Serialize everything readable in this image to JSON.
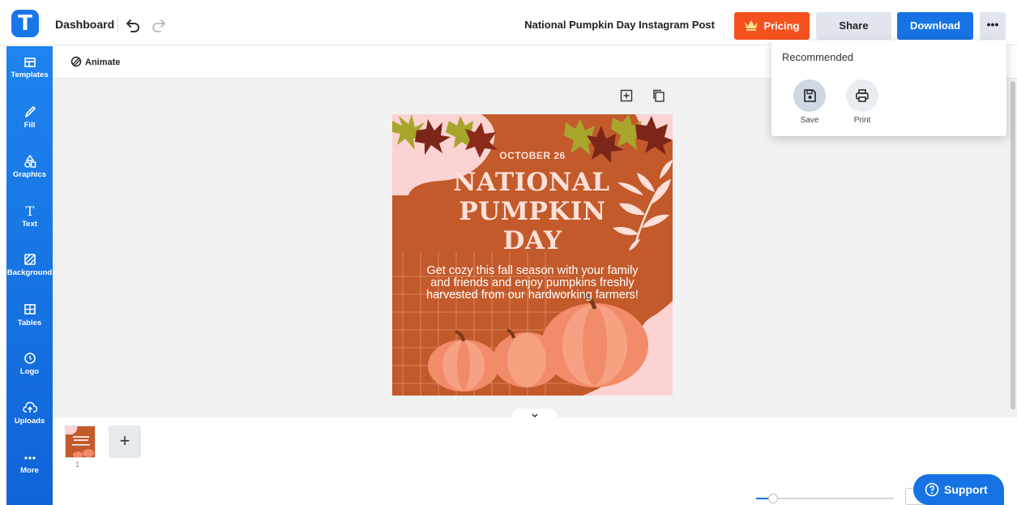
{
  "app": {
    "logo_letter": "T"
  },
  "header": {
    "dashboard_label": "Dashboard",
    "document_title": "National Pumpkin Day Instagram Post",
    "pricing_label": "Pricing",
    "share_label": "Share",
    "download_label": "Download",
    "more_label": "•••",
    "colors": {
      "pricing": "#f4511e",
      "download": "#1773e3",
      "sidebar": "#1877e8"
    }
  },
  "sidebar": {
    "items": [
      {
        "label": "Templates",
        "icon": "templates-icon"
      },
      {
        "label": "Fill",
        "icon": "pencil-icon"
      },
      {
        "label": "Graphics",
        "icon": "shapes-icon"
      },
      {
        "label": "Text",
        "icon": "text-icon"
      },
      {
        "label": "Background",
        "icon": "background-icon"
      },
      {
        "label": "Tables",
        "icon": "table-icon"
      },
      {
        "label": "Logo",
        "icon": "logo-icon"
      },
      {
        "label": "Uploads",
        "icon": "cloud-upload-icon"
      },
      {
        "label": "More",
        "icon": "more-icon"
      }
    ]
  },
  "toolbar": {
    "animate_label": "Animate"
  },
  "design": {
    "date": "OCTOBER 26",
    "title_line1": "NATIONAL",
    "title_line2": "PUMPKIN",
    "title_line3": "DAY",
    "body_line1": "Get cozy this fall season with your family",
    "body_line2": "and friends and enjoy pumpkins freshly",
    "body_line3": "harvested from our hardworking farmers!"
  },
  "pages": {
    "current_page_number": "1",
    "add_label": "+"
  },
  "dropdown": {
    "title": "Recommended",
    "items": [
      {
        "label": "Save",
        "icon": "save-icon"
      },
      {
        "label": "Print",
        "icon": "print-icon"
      }
    ]
  },
  "support": {
    "label": "Support"
  },
  "zoom": {
    "level": 0.1
  }
}
